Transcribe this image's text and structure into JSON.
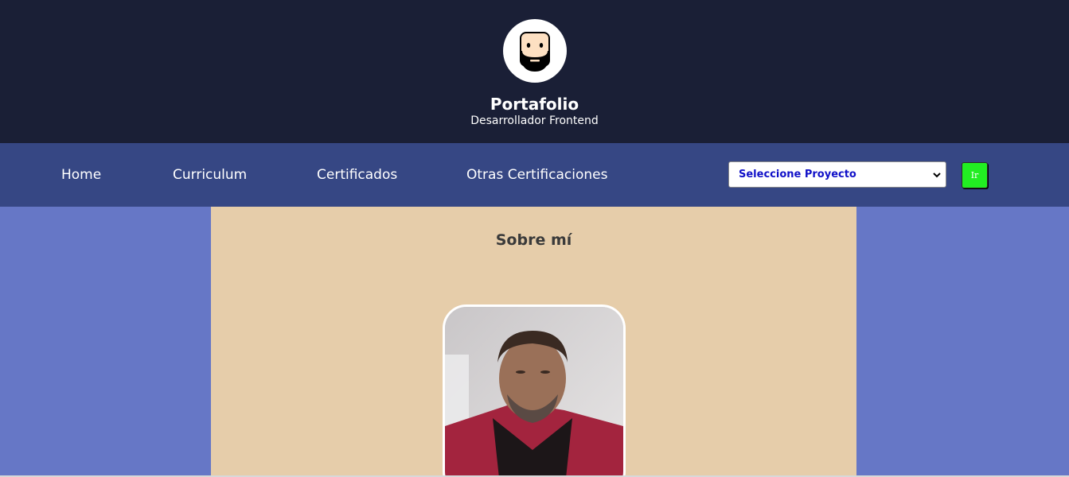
{
  "header": {
    "title": "Portafolio",
    "subtitle": "Desarrollador Frontend",
    "logo_icon": "bearded-face-avatar-icon"
  },
  "nav": {
    "links": [
      {
        "label": "Home"
      },
      {
        "label": "Curriculum"
      },
      {
        "label": "Certificados"
      },
      {
        "label": "Otras Certificaciones"
      }
    ],
    "project_select": {
      "selected": "Seleccione Proyecto"
    },
    "go_button": {
      "label": "Ir"
    }
  },
  "main": {
    "section_title": "Sobre mí"
  },
  "colors": {
    "header_bg": "#1a1f36",
    "nav_bg": "#364784",
    "page_bg": "#6677c6",
    "content_bg": "#e6cdaa",
    "go_button_bg": "#22ee22",
    "select_text": "#1010c8"
  }
}
